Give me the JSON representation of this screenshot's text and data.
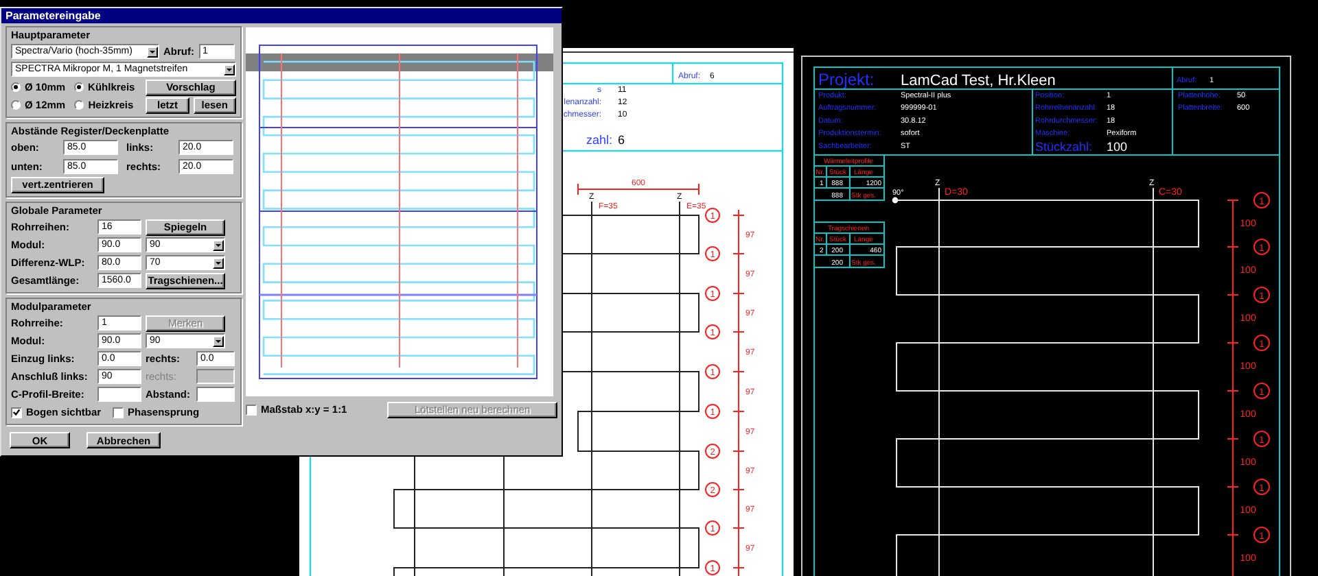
{
  "dialog": {
    "title": "Parametereingabe",
    "main": {
      "title": "Hauptparameter",
      "series": "Spectra/Vario (hoch-35mm)",
      "call_label": "Abruf:",
      "call_value": "1",
      "product": "SPECTRA Mikropor M, 1 Magnetstreifen",
      "diameters": [
        {
          "label": "Ø 10mm",
          "selected": true
        },
        {
          "label": "Ø 12mm",
          "selected": false
        }
      ],
      "circuits": [
        {
          "label": "Kühlkreis",
          "selected": true
        },
        {
          "label": "Heizkreis",
          "selected": false
        }
      ],
      "buttons": [
        "Vorschlag",
        "letzt",
        "lesen"
      ]
    },
    "spacing": {
      "title": "Abstände Register/Deckenplatte",
      "fields": [
        {
          "label": "oben:",
          "value": "85.0"
        },
        {
          "label": "links:",
          "value": "20.0"
        },
        {
          "label": "unten:",
          "value": "85.0"
        },
        {
          "label": "rechts:",
          "value": "20.0"
        }
      ],
      "button": "vert.zentrieren"
    },
    "global": {
      "title": "Globale Parameter",
      "rows": [
        {
          "kind": "button",
          "label": "Rohrreihen:",
          "value": "16",
          "button": "Spiegeln",
          "button_disabled": false
        },
        {
          "kind": "select",
          "label": "Modul:",
          "value": "90.0",
          "option": "90"
        },
        {
          "kind": "select",
          "label": "Differenz-WLP:",
          "value": "80.0",
          "option": "70"
        },
        {
          "kind": "button",
          "label": "Gesamtlänge:",
          "value": "1560.0",
          "button": "Tragschienen...",
          "button_disabled": false
        }
      ]
    },
    "module": {
      "title": "Modulparameter",
      "rows": [
        {
          "kind": "button",
          "label": "Rohrreihe:",
          "value": "1",
          "button": "Merken",
          "button_disabled": true
        },
        {
          "kind": "select",
          "label": "Modul:",
          "value": "90.0",
          "option": "90"
        },
        {
          "kind": "pair",
          "label": "Einzug links:",
          "value": "0.0",
          "label2": "rechts:",
          "value2": "0.0",
          "second_disabled": false
        },
        {
          "kind": "pair",
          "label": "Anschluß links:",
          "value": "90",
          "label2": "rechts:",
          "second_disabled": true
        },
        {
          "kind": "pair",
          "label": "C-Profil-Breite:",
          "label2": "Abstand:",
          "second_disabled": false
        }
      ],
      "checkboxes": [
        {
          "label": "Bogen sichtbar",
          "checked": true
        },
        {
          "label": "Phasensprung",
          "checked": false
        }
      ]
    },
    "preview": {
      "scale_checkbox": {
        "label": "Maßstab x:y = 1:1",
        "checked": false
      },
      "recalc_button": {
        "label": "Lötstellen neu berechnen",
        "disabled": true
      }
    },
    "buttons": [
      "OK",
      "Abbrechen"
    ]
  },
  "sheet": {
    "call_label": "Abruf:",
    "call_value": "6",
    "info": [
      {
        "label": "s",
        "value": "11"
      },
      {
        "label": "lenanzahl:",
        "value": "12"
      },
      {
        "label": "chmesser:",
        "value": "10"
      }
    ],
    "count_label": "zahl:",
    "count_value": "6",
    "dimension": "600",
    "columns": [
      {
        "mark": "Z",
        "label": "F=35"
      },
      {
        "mark": "Z",
        "label": "E=35"
      }
    ],
    "markers": [
      "1",
      "1",
      "1",
      "1",
      "1",
      "1",
      "2",
      "2",
      "1",
      "1"
    ],
    "spacings": [
      "97",
      "97",
      "97",
      "97",
      "97",
      "97",
      "97",
      "97",
      "97"
    ]
  },
  "cad": {
    "project_label": "Projekt:",
    "project": "LamCad Test, Hr.Kleen",
    "call_label": "Abruf:",
    "call_value": "1",
    "info_left": [
      {
        "label": "Produkt:",
        "value": "Spectral-II plus"
      },
      {
        "label": "Auftragsnummer:",
        "value": "999999-01"
      },
      {
        "label": "Datum:",
        "value": "30.8.12"
      },
      {
        "label": "Produktionstermin:",
        "value": "sofort"
      },
      {
        "label": "Sachbearbeiter:",
        "value": "ST"
      }
    ],
    "info_mid": [
      {
        "label": "Position:",
        "value": "1"
      },
      {
        "label": "Rohrreihenanzahl:",
        "value": "18"
      },
      {
        "label": "Rohrdurchmesser:",
        "value": "18"
      },
      {
        "label": "Maschine:",
        "value": "Pexiform"
      }
    ],
    "count_label": "Stückzahl:",
    "count_value": "100",
    "info_right": [
      {
        "label": "Plattenhöhe:",
        "value": "50"
      },
      {
        "label": "Plattenbreite:",
        "value": "600"
      }
    ],
    "tables": [
      {
        "title": "Wärmeleitprofile",
        "columns": [
          "Nr.",
          "Stück",
          "Länge"
        ],
        "row": [
          "1",
          "888",
          "1200"
        ],
        "total": [
          "888",
          "Stk ges."
        ]
      },
      {
        "title": "Tragschienen",
        "columns": [
          "Nr.",
          "Stück",
          "Länge"
        ],
        "row": [
          "2",
          "200",
          "460"
        ],
        "total": [
          "200",
          "Stk ges."
        ]
      }
    ],
    "angle": "90°",
    "columns": [
      {
        "mark": "Z",
        "label": "D=30"
      },
      {
        "mark": "Z",
        "label": "C=30"
      }
    ],
    "markers": [
      "1",
      "1",
      "1",
      "1",
      "1",
      "1",
      "1",
      "1"
    ],
    "spacings": [
      "100",
      "100",
      "100",
      "100",
      "100",
      "100",
      "100",
      "100"
    ]
  }
}
